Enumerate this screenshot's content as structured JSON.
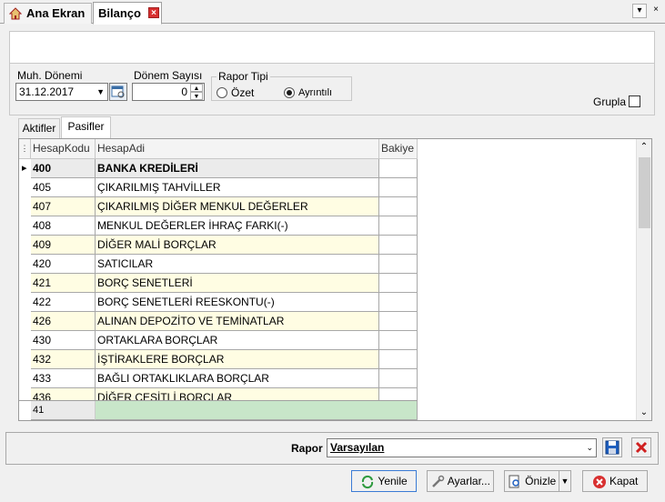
{
  "tabs": [
    {
      "label": "Ana Ekran"
    },
    {
      "label": "Bilanço"
    }
  ],
  "params": {
    "muh_donemi_label": "Muh. Dönemi",
    "muh_donemi_value": "31.12.2017",
    "donem_sayisi_label": "Dönem Sayısı",
    "donem_sayisi_value": "0",
    "rapor_tipi_label": "Rapor Tipi",
    "ozet_label": "Özet",
    "ayrintili_label": "Ayrıntılı",
    "grupla_label": "Grupla"
  },
  "subtabs": [
    {
      "label": "Aktifler"
    },
    {
      "label": "Pasifler"
    }
  ],
  "grid": {
    "columns": [
      "HesapKodu",
      "HesapAdi",
      "Bakiye"
    ],
    "rows": [
      {
        "code": "400",
        "name": "BANKA KREDİLERİ",
        "bakiye": ""
      },
      {
        "code": "405",
        "name": "ÇIKARILMIŞ TAHVİLLER",
        "bakiye": ""
      },
      {
        "code": "407",
        "name": "ÇIKARILMIŞ DİĞER MENKUL DEĞERLER",
        "bakiye": ""
      },
      {
        "code": "408",
        "name": "MENKUL DEĞERLER İHRAÇ FARKI(-)",
        "bakiye": ""
      },
      {
        "code": "409",
        "name": "DİĞER MALİ BORÇLAR",
        "bakiye": ""
      },
      {
        "code": "420",
        "name": "SATICILAR",
        "bakiye": ""
      },
      {
        "code": "421",
        "name": "BORÇ SENETLERİ",
        "bakiye": ""
      },
      {
        "code": "422",
        "name": "BORÇ SENETLERİ REESKONTU(-)",
        "bakiye": ""
      },
      {
        "code": "426",
        "name": "ALINAN DEPOZİTO VE TEMİNATLAR",
        "bakiye": ""
      },
      {
        "code": "430",
        "name": "ORTAKLARA BORÇLAR",
        "bakiye": ""
      },
      {
        "code": "432",
        "name": "İŞTİRAKLERE BORÇLAR",
        "bakiye": ""
      },
      {
        "code": "433",
        "name": "BAĞLI ORTAKLIKLARA BORÇLAR",
        "bakiye": ""
      },
      {
        "code": "436",
        "name": "DİĞER ÇEŞİTLİ BORÇLAR",
        "bakiye": ""
      }
    ],
    "footer_count": "41"
  },
  "rapor": {
    "label": "Rapor",
    "value": "Varsayılan"
  },
  "buttons": {
    "yenile": "Yenile",
    "ayarlar": "Ayarlar...",
    "onizle": "Önizle",
    "kapat": "Kapat"
  },
  "colors": {
    "row_alt": "#fffde3",
    "row_base": "#ffffff",
    "footer_fill": "#c8e6c9",
    "selected_tab": "#ffffff"
  }
}
